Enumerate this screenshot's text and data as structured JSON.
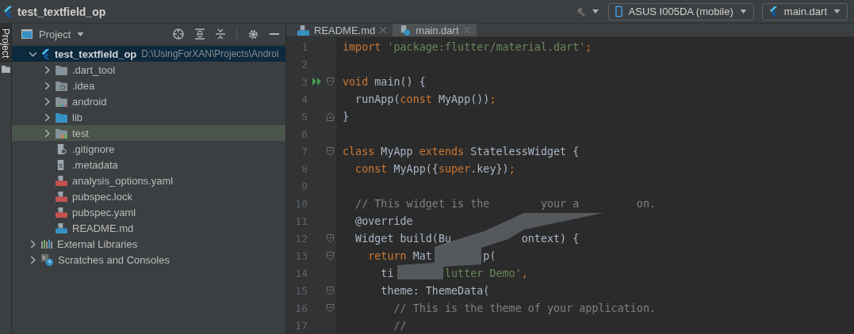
{
  "window": {
    "title": "test_textfield_op"
  },
  "toolbar": {
    "device": "ASUS I005DA (mobile)",
    "config": "main.dart"
  },
  "side_tab": {
    "label": "Project",
    "selected": true
  },
  "project_panel": {
    "title": "Project",
    "tree": [
      {
        "label": "test_textfield_op",
        "path": "D:\\UsingForXAN\\Projects\\Androi",
        "kind": "flutter",
        "expanded": true,
        "selected": true,
        "highlighted": false,
        "children": [
          {
            "label": ".dart_tool",
            "kind": "folder",
            "expanded": false,
            "selected": false,
            "highlighted": false
          },
          {
            "label": ".idea",
            "kind": "idea-folder",
            "expanded": false,
            "selected": false,
            "highlighted": false
          },
          {
            "label": "android",
            "kind": "android-folder",
            "expanded": false,
            "selected": false,
            "highlighted": false
          },
          {
            "label": "lib",
            "kind": "source-folder",
            "expanded": false,
            "selected": false,
            "highlighted": false
          },
          {
            "label": "test",
            "kind": "test-folder",
            "expanded": false,
            "selected": false,
            "highlighted": true
          },
          {
            "label": ".gitignore",
            "kind": "ignore-file",
            "selected": false,
            "highlighted": false
          },
          {
            "label": ".metadata",
            "kind": "text-file",
            "selected": false,
            "highlighted": false
          },
          {
            "label": "analysis_options.yaml",
            "kind": "yaml-file",
            "selected": false,
            "highlighted": false
          },
          {
            "label": "pubspec.lock",
            "kind": "yaml-file",
            "selected": false,
            "highlighted": false
          },
          {
            "label": "pubspec.yaml",
            "kind": "yaml-file",
            "selected": false,
            "highlighted": false
          },
          {
            "label": "README.md",
            "kind": "markdown-file",
            "selected": false,
            "highlighted": false
          }
        ]
      },
      {
        "label": "External Libraries",
        "kind": "libraries",
        "expanded": false,
        "selected": false,
        "highlighted": false
      },
      {
        "label": "Scratches and Consoles",
        "kind": "scratches",
        "expanded": false,
        "selected": false,
        "highlighted": false
      }
    ]
  },
  "editor": {
    "tabs": [
      {
        "label": "README.md",
        "kind": "markdown",
        "selected": false
      },
      {
        "label": "main.dart",
        "kind": "dart",
        "selected": true
      }
    ],
    "lines": [
      {
        "number": "1",
        "run": false,
        "fold_start": false,
        "fold_end": false,
        "tokens": [
          {
            "text": "import ",
            "kind": "kw"
          },
          {
            "text": "'package:flutter/material.dart'",
            "kind": "str"
          },
          {
            "text": ";",
            "kind": "kw"
          }
        ]
      },
      {
        "number": "2",
        "run": false,
        "fold_start": false,
        "fold_end": false
      },
      {
        "number": "3",
        "run": true,
        "fold_start": true,
        "fold_end": false,
        "tokens": [
          {
            "text": "void",
            "kind": "kw"
          },
          {
            "text": " main() {",
            "kind": "plain"
          }
        ]
      },
      {
        "number": "4",
        "run": false,
        "fold_start": false,
        "fold_end": false,
        "tokens": [
          {
            "text": "  runApp(",
            "kind": "plain"
          },
          {
            "text": "const",
            "kind": "kw"
          },
          {
            "text": " MyApp())",
            "kind": "plain"
          },
          {
            "text": ";",
            "kind": "kw"
          }
        ]
      },
      {
        "number": "5",
        "run": false,
        "fold_start": false,
        "fold_end": true,
        "tokens": [
          {
            "text": "}",
            "kind": "plain"
          }
        ]
      },
      {
        "number": "6",
        "run": false,
        "fold_start": false,
        "fold_end": false
      },
      {
        "number": "7",
        "run": false,
        "fold_start": true,
        "fold_end": false,
        "tokens": [
          {
            "text": "class",
            "kind": "kw"
          },
          {
            "text": " MyApp ",
            "kind": "plain"
          },
          {
            "text": "extends",
            "kind": "kw"
          },
          {
            "text": " StatelessWidget {",
            "kind": "plain"
          }
        ]
      },
      {
        "number": "8",
        "run": false,
        "fold_start": false,
        "fold_end": false,
        "tokens": [
          {
            "text": "  const",
            "kind": "kw"
          },
          {
            "text": " MyApp({",
            "kind": "plain"
          },
          {
            "text": "super",
            "kind": "kw"
          },
          {
            "text": ".key})",
            "kind": "plain"
          },
          {
            "text": ";",
            "kind": "kw"
          }
        ]
      },
      {
        "number": "9",
        "run": false,
        "fold_start": false,
        "fold_end": false
      },
      {
        "number": "10",
        "run": false,
        "fold_start": false,
        "fold_end": false,
        "tokens": [
          {
            "text": "  // This widget is the        your a         on.",
            "kind": "com"
          }
        ]
      },
      {
        "number": "11",
        "run": false,
        "fold_start": false,
        "fold_end": false,
        "tokens": [
          {
            "text": "  @override",
            "kind": "plain"
          }
        ]
      },
      {
        "number": "12",
        "run": false,
        "fold_start": true,
        "fold_end": false,
        "tokens": [
          {
            "text": "  Widget build(Bu           ontext) {",
            "kind": "plain"
          }
        ]
      },
      {
        "number": "13",
        "run": false,
        "fold_start": true,
        "fold_end": false,
        "tokens": [
          {
            "text": "    return",
            "kind": "kw"
          },
          {
            "text": " Mat        p(",
            "kind": "plain"
          }
        ]
      },
      {
        "number": "14",
        "run": false,
        "fold_start": false,
        "fold_end": false,
        "tokens": [
          {
            "text": "      ti        ",
            "kind": "plain"
          },
          {
            "text": "lutter Demo'",
            "kind": "str"
          },
          {
            "text": ",",
            "kind": "kw"
          }
        ]
      },
      {
        "number": "15",
        "run": false,
        "fold_start": true,
        "fold_end": false,
        "tokens": [
          {
            "text": "      theme: ThemeData(",
            "kind": "plain"
          }
        ]
      },
      {
        "number": "16",
        "run": false,
        "fold_start": true,
        "fold_end": false,
        "tokens": [
          {
            "text": "        // This is the theme of your application.",
            "kind": "com"
          }
        ]
      },
      {
        "number": "17",
        "run": false,
        "fold_start": false,
        "fold_end": false,
        "tokens": [
          {
            "text": "        //",
            "kind": "com"
          }
        ]
      }
    ]
  }
}
